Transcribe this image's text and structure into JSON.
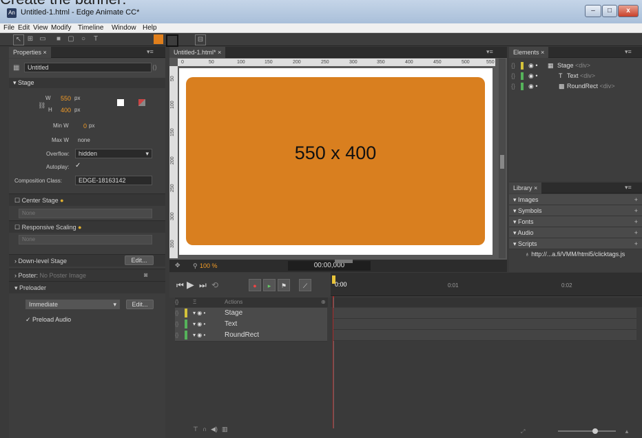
{
  "overlay_text": "Create the banner:",
  "window": {
    "title": "Untitled-1.html - Edge Animate CC*",
    "app_icon": "An",
    "minimize": "–",
    "maximize": "□",
    "close": "x"
  },
  "menu": [
    "File",
    "Edit",
    "View",
    "Modify",
    "Timeline",
    "Window",
    "Help"
  ],
  "properties": {
    "tab": "Properties",
    "element_name": "Untitled",
    "stage_section": "Stage",
    "w_label": "W",
    "w_value": "550",
    "h_label": "H",
    "h_value": "400",
    "unit": "px",
    "min_w_label": "Min W",
    "min_w_value": "0",
    "max_w_label": "Max W",
    "max_w_value": "none",
    "overflow_label": "Overflow:",
    "overflow_value": "hidden",
    "autoplay_label": "Autoplay:",
    "composition_class_label": "Composition Class:",
    "composition_class_value": "EDGE-18163142",
    "center_stage": "Center Stage",
    "center_stage_select": "None",
    "responsive_scaling": "Responsive Scaling",
    "responsive_select": "None",
    "downlevel_stage": "Down-level Stage",
    "edit_label": "Edit...",
    "poster_label": "Poster:",
    "poster_value": "No Poster Image",
    "preloader": "Preloader",
    "preloader_value": "Immediate",
    "preload_audio": "Preload Audio"
  },
  "stage": {
    "tab": "Untitled-1.html*",
    "text": "550 x 400",
    "zoom": "100 %",
    "time": "00:00,000",
    "ruler_h": [
      "0",
      "50",
      "100",
      "150",
      "200",
      "250",
      "300",
      "350",
      "400",
      "450",
      "500",
      "550"
    ],
    "ruler_v": [
      "50",
      "100",
      "150",
      "200",
      "250",
      "300",
      "350"
    ],
    "rect_color": "#d97f1f"
  },
  "elements": {
    "tab": "Elements",
    "items": [
      {
        "name": "Stage",
        "tag": "<div>",
        "color": "#d4c23a"
      },
      {
        "name": "Text",
        "tag": "<div>",
        "color": "#55b35a"
      },
      {
        "name": "RoundRect",
        "tag": "<div>",
        "color": "#55b35a"
      }
    ]
  },
  "library": {
    "tab": "Library",
    "sections": [
      "Images",
      "Symbols",
      "Fonts",
      "Audio",
      "Scripts"
    ],
    "script_item": "http://...a.fi/VMM/html5/clicktags.js"
  },
  "timeline": {
    "actions_label": "Actions",
    "rows": [
      {
        "name": "Stage",
        "color": "#d4c23a"
      },
      {
        "name": "Text",
        "color": "#55b35a"
      },
      {
        "name": "RoundRect",
        "color": "#55b35a"
      }
    ],
    "times": [
      "0:00",
      "0:01",
      "0:02"
    ]
  }
}
